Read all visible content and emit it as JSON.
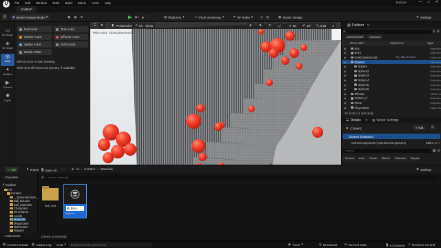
{
  "menu": [
    "File",
    "Edit",
    "Window",
    "Tools",
    "Build",
    "Select",
    "Actor",
    "Help"
  ],
  "window": {
    "title_right": "Explore",
    "doc_tab": "Untitled*"
  },
  "toolbar": {
    "mode": "Motion Design Mode",
    "platforms": "Platforms",
    "pixel_streaming": "Pixel Streaming",
    "vp_roles": "VP Roles",
    "motion_design": "Motion Design",
    "settings": "Settings"
  },
  "rail": [
    {
      "label": "2D Shape",
      "icon": "shape-2d-icon"
    },
    {
      "label": "3D Shape",
      "icon": "shape-3d-icon"
    },
    {
      "label": "Actor",
      "icon": "actor-icon"
    },
    {
      "label": "Modifiers",
      "icon": "modifiers-icon"
    },
    {
      "label": "Camera",
      "icon": "camera-icon"
    },
    {
      "label": "Lights",
      "icon": "lights-icon"
    }
  ],
  "tools": {
    "buttons": [
      {
        "label": "Null Actor",
        "color": "#8a8a8a"
      },
      {
        "label": "Text Actor",
        "color": "#8a8a8a"
      },
      {
        "label": "Cloner Actor",
        "color": "#e08a2c"
      },
      {
        "label": "Effector Actor",
        "color": "#d05a5a"
      },
      {
        "label": "Spline Actor",
        "color": "#5aa0d0"
      },
      {
        "label": "SVG Actor",
        "color": "#8a8a8a"
      },
      {
        "label": "Media Plate",
        "color": "#8a8a8a"
      }
    ],
    "hint1": "Select a tool to start drawing.",
    "hint2": "Shift-click will show tool presets, if available."
  },
  "viewport": {
    "perspective": "Perspective",
    "lit": "Lit",
    "show": "Show",
    "pilot": "Pilot Actor: CineCameraActor0",
    "snap_value": "10",
    "angle_value": "10°",
    "scale_value": "0.25",
    "cam_speed": "4"
  },
  "outliner": {
    "title": "Outliner",
    "filter_tabs": [
      "Unreferenced",
      "Unsaved"
    ],
    "col_label": "Item Label",
    "col_seq": "Sequencer",
    "col_type": "Type",
    "rows": [
      {
        "label": "Box",
        "type": "StaticMes",
        "indent": 1,
        "selected": false
      },
      {
        "label": "Box2",
        "type": "StaticMes",
        "indent": 1,
        "selected": false
      },
      {
        "label": "CineCameraActor",
        "type": "CineCam",
        "indent": 1,
        "selected": false,
        "extra": "SQ_Ball_Bounce"
      },
      {
        "label": "Cloner2",
        "type": "CEClone",
        "indent": 1,
        "selected": true
      },
      {
        "label": "Sphere",
        "type": "StaticMes",
        "indent": 2,
        "selected": false
      },
      {
        "label": "Sphere2",
        "type": "StaticMes",
        "indent": 2,
        "selected": false
      },
      {
        "label": "Sphere3",
        "type": "StaticMes",
        "indent": 2,
        "selected": false
      },
      {
        "label": "Sphere4",
        "type": "StaticMes",
        "indent": 2,
        "selected": false
      },
      {
        "label": "Sphere5",
        "type": "StaticMes",
        "indent": 2,
        "selected": false
      },
      {
        "label": "Sphere6",
        "type": "StaticMes",
        "indent": 2,
        "selected": false
      },
      {
        "label": "Effector",
        "type": "CEEffect",
        "indent": 1,
        "selected": false
      },
      {
        "label": "Pattern_0",
        "type": "StaticMes",
        "indent": 1,
        "selected": false
      },
      {
        "label": "Plane",
        "type": "StaticMes",
        "indent": 1,
        "selected": false
      },
      {
        "label": "PlayerStart",
        "type": "PlayerStart",
        "indent": 1,
        "selected": false
      }
    ],
    "count": "22 actors (1 selected)"
  },
  "details": {
    "tab": "Details",
    "tab2": "World Settings",
    "object": "Cloner2",
    "add": "+ Add",
    "component": "Cloner2 (Instance)",
    "subcomponent": "ClonerComponent (AvaClonerComponent)",
    "edit": "Edit in C++",
    "search_placeholder": "Search",
    "cats": [
      "General",
      "Actor",
      "Cloner",
      "Effector",
      "Extension",
      "Physics"
    ]
  },
  "content_browser": {
    "add": "+ Add",
    "import": "Import",
    "save_all": "Save All",
    "path": [
      "All",
      "Content",
      "Materials"
    ],
    "settings": "Settings",
    "search_placeholder": "Search Materials",
    "favorites": "Favorites",
    "explore": "Explore",
    "tree": [
      {
        "label": "All",
        "indent": 0
      },
      {
        "label": "Content",
        "indent": 1
      },
      {
        "label": "__ExternalActors__",
        "indent": 2
      },
      {
        "label": "Ball_Bounce",
        "indent": 2
      },
      {
        "label": "Ball_Materials",
        "indent": 2
      },
      {
        "label": "Characters",
        "indent": 2
      },
      {
        "label": "Developers",
        "indent": 2
      },
      {
        "label": "Levels",
        "indent": 2
      },
      {
        "label": "Materials",
        "indent": 2,
        "selected": true
      },
      {
        "label": "Megascans",
        "indent": 2
      },
      {
        "label": "MSPresets",
        "indent": 2
      },
      {
        "label": "Niagara",
        "indent": 2
      }
    ],
    "assets": [
      {
        "name": "Ball_Test",
        "kind": "folder"
      },
      {
        "name": "M_BALL",
        "kind": "Material",
        "selected": true
      }
    ],
    "collections": "Collections",
    "item_count": "2 items (1 selected)"
  },
  "statusbar": {
    "content_drawer": "Content Drawer",
    "output_log": "Output Log",
    "cmd": "Cmd",
    "cmd_placeholder": "Enter Console Command",
    "trace": "Trace",
    "broadcast": "Broadcast",
    "derived": "Derived Data",
    "unsaved": "6 Unsaved",
    "revision": "Revision Control"
  }
}
